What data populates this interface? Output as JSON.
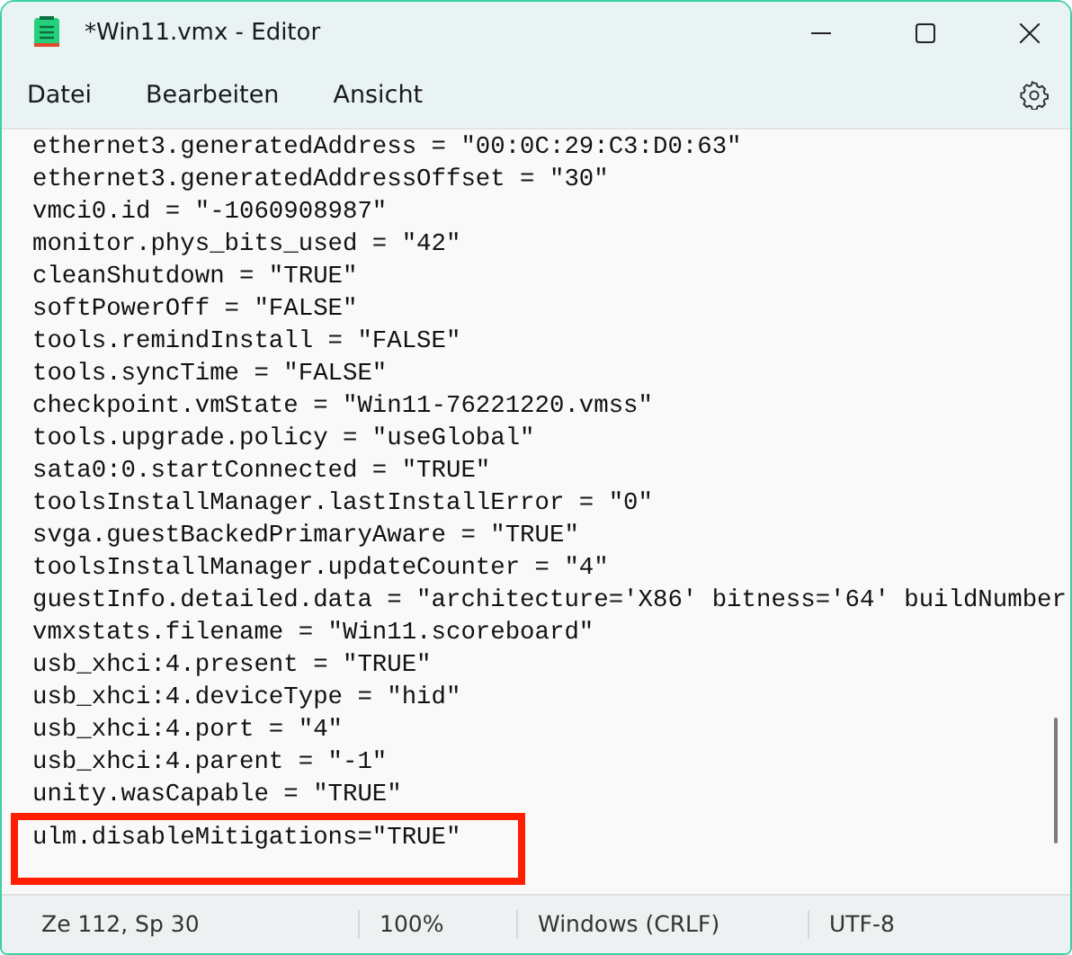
{
  "window": {
    "title": "*Win11.vmx - Editor"
  },
  "menu": [
    {
      "label": "Datei"
    },
    {
      "label": "Bearbeiten"
    },
    {
      "label": "Ansicht"
    }
  ],
  "editor": {
    "lines": [
      {
        "text": "ethernet3.generatedAddress = \"00:0C:29:C3:D0:63\"",
        "highlighted": false
      },
      {
        "text": "ethernet3.generatedAddressOffset = \"30\"",
        "highlighted": false
      },
      {
        "text": "vmci0.id = \"-1060908987\"",
        "highlighted": false
      },
      {
        "text": "monitor.phys_bits_used = \"42\"",
        "highlighted": false
      },
      {
        "text": "cleanShutdown = \"TRUE\"",
        "highlighted": false
      },
      {
        "text": "softPowerOff = \"FALSE\"",
        "highlighted": false
      },
      {
        "text": "tools.remindInstall = \"FALSE\"",
        "highlighted": false
      },
      {
        "text": "tools.syncTime = \"FALSE\"",
        "highlighted": false
      },
      {
        "text": "checkpoint.vmState = \"Win11-76221220.vmss\"",
        "highlighted": false
      },
      {
        "text": "tools.upgrade.policy = \"useGlobal\"",
        "highlighted": false
      },
      {
        "text": "sata0:0.startConnected = \"TRUE\"",
        "highlighted": false
      },
      {
        "text": "toolsInstallManager.lastInstallError = \"0\"",
        "highlighted": false
      },
      {
        "text": "svga.guestBackedPrimaryAware = \"TRUE\"",
        "highlighted": false
      },
      {
        "text": "toolsInstallManager.updateCounter = \"4\"",
        "highlighted": false
      },
      {
        "text": "guestInfo.detailed.data = \"architecture='X86' bitness='64' buildNumber",
        "highlighted": false
      },
      {
        "text": "vmxstats.filename = \"Win11.scoreboard\"",
        "highlighted": false
      },
      {
        "text": "usb_xhci:4.present = \"TRUE\"",
        "highlighted": false
      },
      {
        "text": "usb_xhci:4.deviceType = \"hid\"",
        "highlighted": false
      },
      {
        "text": "usb_xhci:4.port = \"4\"",
        "highlighted": false
      },
      {
        "text": "usb_xhci:4.parent = \"-1\"",
        "highlighted": false
      },
      {
        "text": "unity.wasCapable = \"TRUE\"",
        "highlighted": false
      },
      {
        "text": "ulm.disableMitigations=\"TRUE\"",
        "highlighted": true
      }
    ]
  },
  "status_bar": [
    {
      "text": "Ze 112, Sp 30"
    },
    {
      "text": "100%"
    },
    {
      "text": "Windows (CRLF)"
    },
    {
      "text": "UTF-8"
    }
  ]
}
